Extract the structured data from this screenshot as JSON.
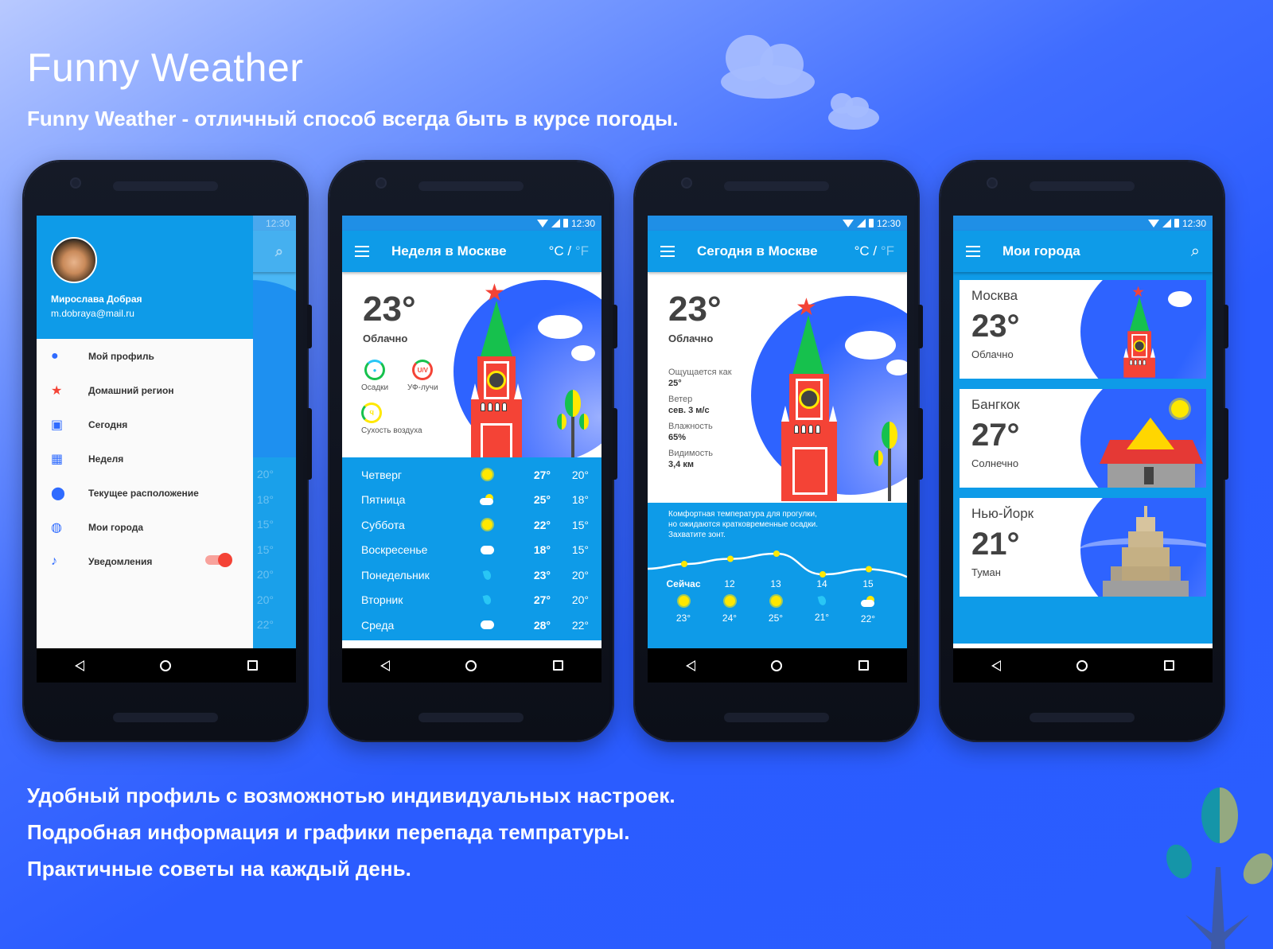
{
  "header": {
    "title": "Funny Weather",
    "subtitle": "Funny Weather - отличный способ всегда быть в курсе погоды."
  },
  "features": [
    "Удобный профиль с возможнотью индивидуальных настроек.",
    "Подробная информация и графики перепада темпратуры.",
    "Практичные советы на каждый день."
  ],
  "colors": {
    "appbar": "#0e9be8",
    "statusbar": "#1f8fe6",
    "accent_red": "#f44336",
    "accent_green": "#16c14d",
    "accent_yellow": "#ffe800",
    "icon_blue": "#2f6bff"
  },
  "status": {
    "time": "12:30"
  },
  "phone1": {
    "drawer": {
      "user_name": "Мирослава Добрая",
      "user_email": "m.dobraya@mail.ru",
      "items": [
        {
          "label": "Мой профиль",
          "icon": "person-icon"
        },
        {
          "label": "Домашний регион",
          "icon": "star-icon"
        },
        {
          "label": "Сегодня",
          "icon": "calendar-check-icon"
        },
        {
          "label": "Неделя",
          "icon": "calendar-grid-icon"
        },
        {
          "label": "Текущее расположение",
          "icon": "location-pin-icon"
        },
        {
          "label": "Мои города",
          "icon": "globe-icon"
        },
        {
          "label": "Уведомления",
          "icon": "bell-icon",
          "toggle": true
        }
      ]
    },
    "behind_lows": [
      "20°",
      "18°",
      "15°",
      "15°",
      "20°",
      "20°",
      "22°"
    ]
  },
  "phone2": {
    "title": "Неделя в Москве",
    "unit_c": "°C",
    "unit_sep": " / ",
    "unit_f": "°F",
    "temp": "23°",
    "condition": "Облачно",
    "indicators": [
      {
        "label": "Осадки",
        "glyph": "💧"
      },
      {
        "label": "УФ-лучи",
        "glyph": "U/V"
      },
      {
        "label": "Сухость воздуха",
        "glyph": "Ϥ"
      }
    ],
    "week": [
      {
        "day": "Четверг",
        "icon": "sun",
        "hi": "27°",
        "lo": "20°"
      },
      {
        "day": "Пятница",
        "icon": "suncloud",
        "hi": "25°",
        "lo": "18°"
      },
      {
        "day": "Суббота",
        "icon": "sun",
        "hi": "22°",
        "lo": "15°"
      },
      {
        "day": "Воскресенье",
        "icon": "cloud",
        "hi": "18°",
        "lo": "15°"
      },
      {
        "day": "Понедельник",
        "icon": "drop",
        "hi": "23°",
        "lo": "20°"
      },
      {
        "day": "Вторник",
        "icon": "drop",
        "hi": "27°",
        "lo": "20°"
      },
      {
        "day": "Среда",
        "icon": "cloud",
        "hi": "28°",
        "lo": "22°"
      }
    ]
  },
  "phone3": {
    "title": "Сегодня в Москве",
    "unit_c": "°C",
    "unit_sep": " / ",
    "unit_f": "°F",
    "temp": "23°",
    "condition": "Облачно",
    "details": [
      {
        "label": "Ощущается как",
        "value": "25°"
      },
      {
        "label": "Ветер",
        "value": "сев. 3 м/с"
      },
      {
        "label": "Влажность",
        "value": "65%"
      },
      {
        "label": "Видимость",
        "value": "3,4 км"
      }
    ],
    "tip": [
      "Комфортная температура для прогулки,",
      "но ожидаются кратковременные осадки.",
      "Захватите зонт."
    ],
    "hours": [
      {
        "label": "Сейчас",
        "icon": "sun",
        "temp": "23°",
        "value": 23
      },
      {
        "label": "12",
        "icon": "sun",
        "temp": "24°",
        "value": 24
      },
      {
        "label": "13",
        "icon": "sun",
        "temp": "25°",
        "value": 25
      },
      {
        "label": "14",
        "icon": "drop",
        "temp": "21°",
        "value": 21
      },
      {
        "label": "15",
        "icon": "suncloud",
        "temp": "22°",
        "value": 22
      }
    ]
  },
  "phone4": {
    "title": "Мои города",
    "cities": [
      {
        "name": "Москва",
        "temp": "23°",
        "condition": "Облачно"
      },
      {
        "name": "Бангкок",
        "temp": "27°",
        "condition": "Солнечно"
      },
      {
        "name": "Нью-Йорк",
        "temp": "21°",
        "condition": "Туман"
      }
    ]
  }
}
